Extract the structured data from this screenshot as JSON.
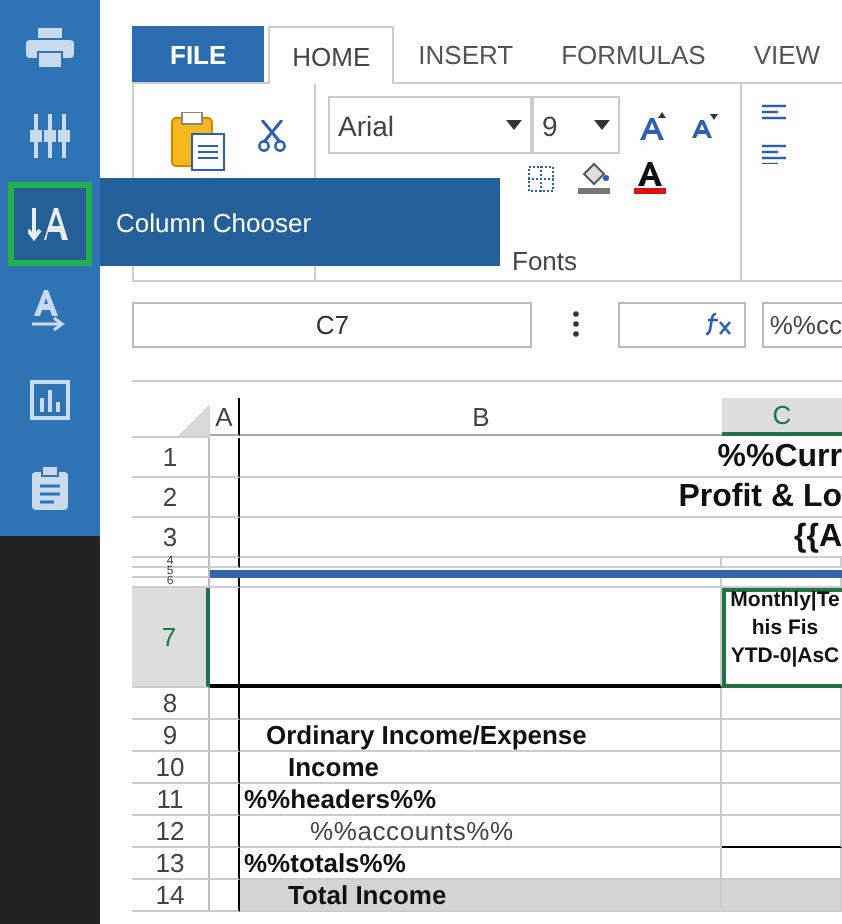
{
  "sidebar": {
    "items": [
      {
        "selected": false
      },
      {
        "selected": false
      },
      {
        "selected": true
      },
      {
        "selected": false
      },
      {
        "selected": false
      },
      {
        "selected": false
      }
    ]
  },
  "tooltip": {
    "text": "Column Chooser"
  },
  "tabs": [
    {
      "label": "FILE",
      "kind": "file",
      "selected": false
    },
    {
      "label": "HOME",
      "kind": "tab",
      "selected": true
    },
    {
      "label": "INSERT",
      "kind": "tab",
      "selected": false
    },
    {
      "label": "FORMULAS",
      "kind": "tab",
      "selected": false
    },
    {
      "label": "VIEW",
      "kind": "tab",
      "selected": false
    }
  ],
  "ribbon": {
    "font": "Arial",
    "size": "9",
    "groups": [
      "Fonts"
    ]
  },
  "formula_bar": {
    "cell": "C7",
    "formula": "%%cc"
  },
  "columns": [
    {
      "label": "A",
      "selected": false
    },
    {
      "label": "B",
      "selected": false
    },
    {
      "label": "C",
      "selected": true
    }
  ],
  "rows": [
    {
      "number": "1",
      "kind": "title",
      "selected": false,
      "text": "%%Curr"
    },
    {
      "number": "2",
      "kind": "title",
      "selected": false,
      "text": "Profit & Lo"
    },
    {
      "number": "3",
      "kind": "title",
      "selected": false,
      "text": "{{A"
    },
    {
      "number": "4",
      "kind": "tiny",
      "selected": false
    },
    {
      "number": "5",
      "kind": "band",
      "selected": false
    },
    {
      "number": "6",
      "kind": "tiny",
      "selected": false
    },
    {
      "number": "7",
      "kind": "header",
      "selected": true,
      "lines": [
        "Monthly|Te",
        "his Fis",
        "YTD-0|AsC"
      ]
    },
    {
      "number": "8",
      "kind": "empty",
      "selected": false
    },
    {
      "number": "9",
      "kind": "heading",
      "selected": false,
      "text": "Ordinary Income/Expense"
    },
    {
      "number": "10",
      "kind": "group",
      "selected": false,
      "text": "Income"
    },
    {
      "number": "11",
      "kind": "template",
      "selected": false,
      "text": "%%headers%%"
    },
    {
      "number": "12",
      "kind": "account",
      "selected": false,
      "text": "%%accounts%%"
    },
    {
      "number": "13",
      "kind": "template",
      "selected": false,
      "text": "%%totals%%"
    },
    {
      "number": "14",
      "kind": "total",
      "selected": false,
      "text": "Total Income"
    }
  ]
}
